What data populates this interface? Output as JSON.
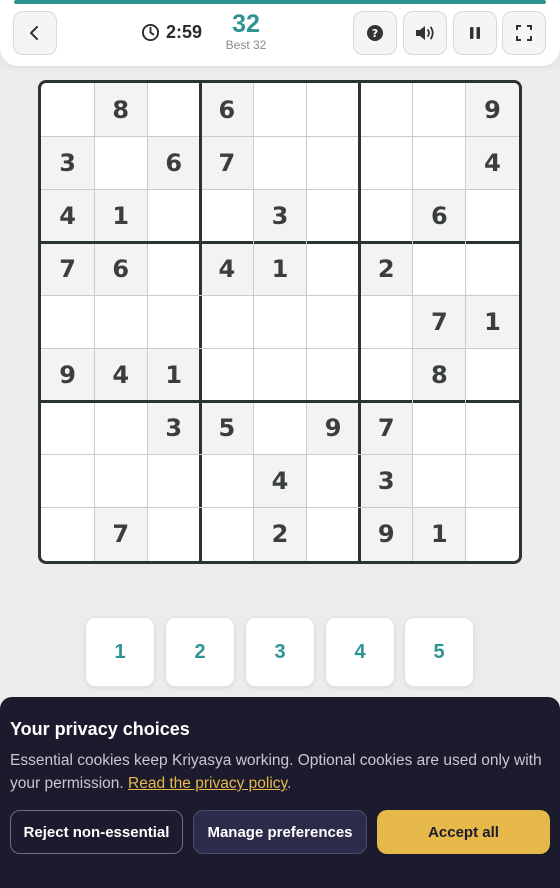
{
  "header": {
    "timer": "2:59",
    "score": "32",
    "best": "Best 32",
    "icons": {
      "back": "chevron-left-icon",
      "clock": "clock-icon",
      "help": "question-icon",
      "sound": "speaker-icon",
      "pause": "pause-icon",
      "fullscreen": "fullscreen-icon"
    }
  },
  "board": {
    "size": 9,
    "cells": [
      [
        "",
        "8",
        "",
        "6",
        "",
        "",
        "",
        "",
        "9"
      ],
      [
        "3",
        "",
        "6",
        "7",
        "",
        "",
        "",
        "",
        "4"
      ],
      [
        "4",
        "1",
        "",
        "",
        "3",
        "",
        "",
        "6",
        ""
      ],
      [
        "7",
        "6",
        "",
        "4",
        "1",
        "",
        "2",
        "",
        ""
      ],
      [
        "",
        "",
        "",
        "",
        "",
        "",
        "",
        "7",
        "1"
      ],
      [
        "9",
        "4",
        "1",
        "",
        "",
        "",
        "",
        "8",
        ""
      ],
      [
        "",
        "",
        "3",
        "5",
        "",
        "9",
        "7",
        "",
        ""
      ],
      [
        "",
        "",
        "",
        "",
        "4",
        "",
        "3",
        "",
        ""
      ],
      [
        "",
        "7",
        "",
        "",
        "2",
        "",
        "9",
        "1",
        ""
      ]
    ]
  },
  "numpad": {
    "keys": [
      "1",
      "2",
      "3",
      "4",
      "5"
    ]
  },
  "cookie": {
    "title": "Your privacy choices",
    "text": "Essential cookies keep Kriyasya working. Optional cookies are used only with your permission. ",
    "link": "Read the privacy policy",
    "after_link": ".",
    "reject": "Reject non-essential",
    "manage": "Manage preferences",
    "accept": "Accept all"
  },
  "colors": {
    "accent": "#2e9393",
    "banner": "#1c1b2e",
    "accept": "#e6b84a"
  }
}
